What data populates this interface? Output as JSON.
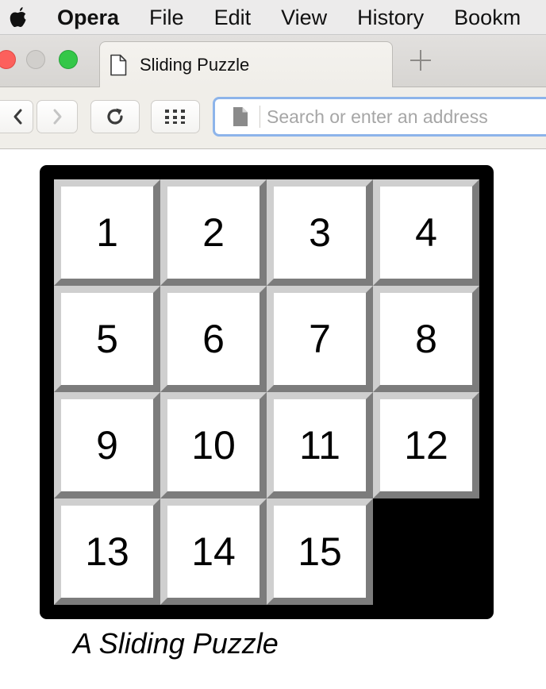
{
  "menubar": {
    "app_name": "Opera",
    "items": [
      "File",
      "Edit",
      "View",
      "History",
      "Bookm"
    ]
  },
  "tabs": [
    {
      "title": "Sliding Puzzle",
      "active": true
    }
  ],
  "newtab": {
    "label": "+"
  },
  "toolbar": {
    "address_placeholder": "Search or enter an address",
    "address_value": ""
  },
  "puzzle": {
    "tiles": [
      [
        "1",
        "2",
        "3",
        "4"
      ],
      [
        "5",
        "6",
        "7",
        "8"
      ],
      [
        "9",
        "10",
        "11",
        "12"
      ],
      [
        "13",
        "14",
        "15",
        null
      ]
    ],
    "caption": "A Sliding Puzzle"
  },
  "colors": {
    "board": "#000000",
    "tile_face": "#ffffff",
    "tile_highlight": "#cfcfcf",
    "tile_shadow": "#7c7c7c",
    "address_focus": "#8db4ea"
  }
}
